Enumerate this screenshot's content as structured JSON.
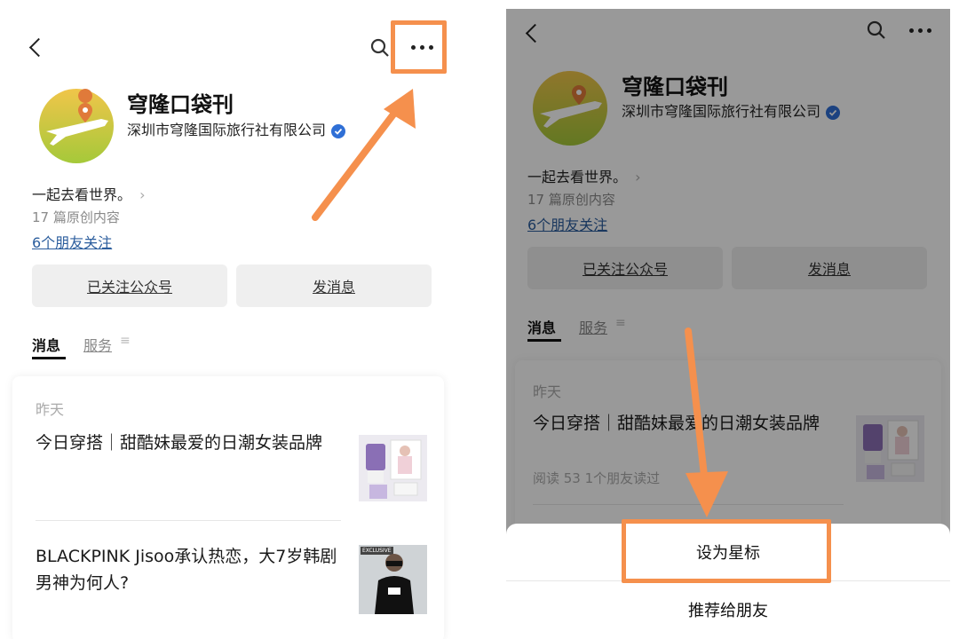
{
  "account": {
    "name": "穹隆口袋刊",
    "company": "深圳市穹隆国际旅行社有限公司",
    "bio": "一起去看世界。",
    "bio_arrow": "›",
    "original_count": "17 篇原创内容",
    "friends_follow": "6个朋友关注"
  },
  "buttons": {
    "followed": "已关注公众号",
    "message": "发消息"
  },
  "tabs": {
    "messages": "消息",
    "services": "服务",
    "services_menu_icon": "≡"
  },
  "feed": {
    "date": "昨天",
    "articles": [
      {
        "title": "今日穿搭｜甜酷妹最爱的日潮女装品牌",
        "meta": "阅读 53  1个朋友读过"
      },
      {
        "title": "BLACKPINK Jisoo承认热恋，大7岁韩剧男神为何人?",
        "thumb_badge": "EXCLUSIVE"
      }
    ]
  },
  "sheet": {
    "star": "设为星标",
    "recommend": "推荐给朋友"
  },
  "colors": {
    "highlight": "#f5904d",
    "link": "#2b5d9d",
    "verified": "#2f6fd6",
    "overlay": "rgba(0,0,0,0.4)"
  },
  "icons": [
    "back-chevron-icon",
    "search-icon",
    "more-dots-icon",
    "verified-icon",
    "logo-airplane-icon",
    "menu-icon"
  ]
}
